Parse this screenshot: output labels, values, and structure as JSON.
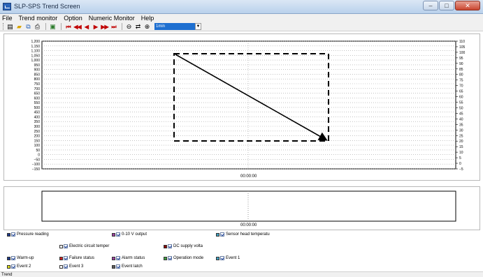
{
  "window": {
    "title": "SLP-SPS Trend Screen",
    "buttons": [
      "–",
      "□",
      "✕"
    ]
  },
  "menu": [
    "File",
    "Trend monitor",
    "Option",
    "Numeric Monitor",
    "Help"
  ],
  "toolbar": {
    "icons": [
      "chart-icon",
      "open-icon",
      "copy-icon",
      "print-icon",
      "image-icon"
    ],
    "nav": [
      "⏮",
      "◀◀",
      "◀",
      "▶",
      "▶▶",
      "⏭"
    ],
    "zoom": [
      "🔍",
      "⇄",
      "🔎"
    ],
    "range_value": "1min",
    "dropdown_arrow": "▼"
  },
  "chart": {
    "left_ticks": [
      "1,200",
      "1,150",
      "1,100",
      "1,050",
      "1,000",
      "950",
      "900",
      "850",
      "800",
      "750",
      "700",
      "650",
      "600",
      "550",
      "500",
      "450",
      "400",
      "350",
      "300",
      "250",
      "200",
      "150",
      "100",
      "50",
      "0",
      "−50",
      "−100",
      "−150"
    ],
    "right_ticks": [
      "110",
      "105",
      "100",
      "95",
      "90",
      "85",
      "80",
      "75",
      "70",
      "65",
      "60",
      "55",
      "50",
      "45",
      "40",
      "35",
      "30",
      "25",
      "20",
      "15",
      "10",
      "5",
      "0",
      "−5"
    ],
    "time_label": "00:00:00",
    "annotation": {
      "box_color": "#000000",
      "arrow_color": "#000000"
    }
  },
  "chart2": {
    "time_label": "00:00:00"
  },
  "legend": [
    {
      "label": "Pressure reading",
      "color": "#1e3a8a",
      "checked": true
    },
    {
      "label": "0-10 V output",
      "color": "#a040a0",
      "checked": true
    },
    {
      "label": "Sensor head temperatu",
      "color": "#40a0c0",
      "checked": true
    },
    {
      "label": "Electric circuit temper",
      "color": "#ffffff",
      "checked": true
    },
    {
      "label": "DC supply volta",
      "color": "#8b0000",
      "checked": true
    },
    {
      "label": "Warm-up",
      "color": "#1e3a8a",
      "checked": true
    },
    {
      "label": "Failure status",
      "color": "#d02020",
      "checked": true
    },
    {
      "label": "Alarm status",
      "color": "#a040a0",
      "checked": true
    },
    {
      "label": "Operation mode",
      "color": "#40a040",
      "checked": true
    },
    {
      "label": "Event 1",
      "color": "#40a0c0",
      "checked": true
    },
    {
      "label": "Event 2",
      "color": "#e0e020",
      "checked": true
    },
    {
      "label": "Event 3",
      "color": "#ffffff",
      "checked": true
    },
    {
      "label": "Event latch",
      "color": "#606060",
      "checked": true
    }
  ],
  "status_text": "Trend"
}
